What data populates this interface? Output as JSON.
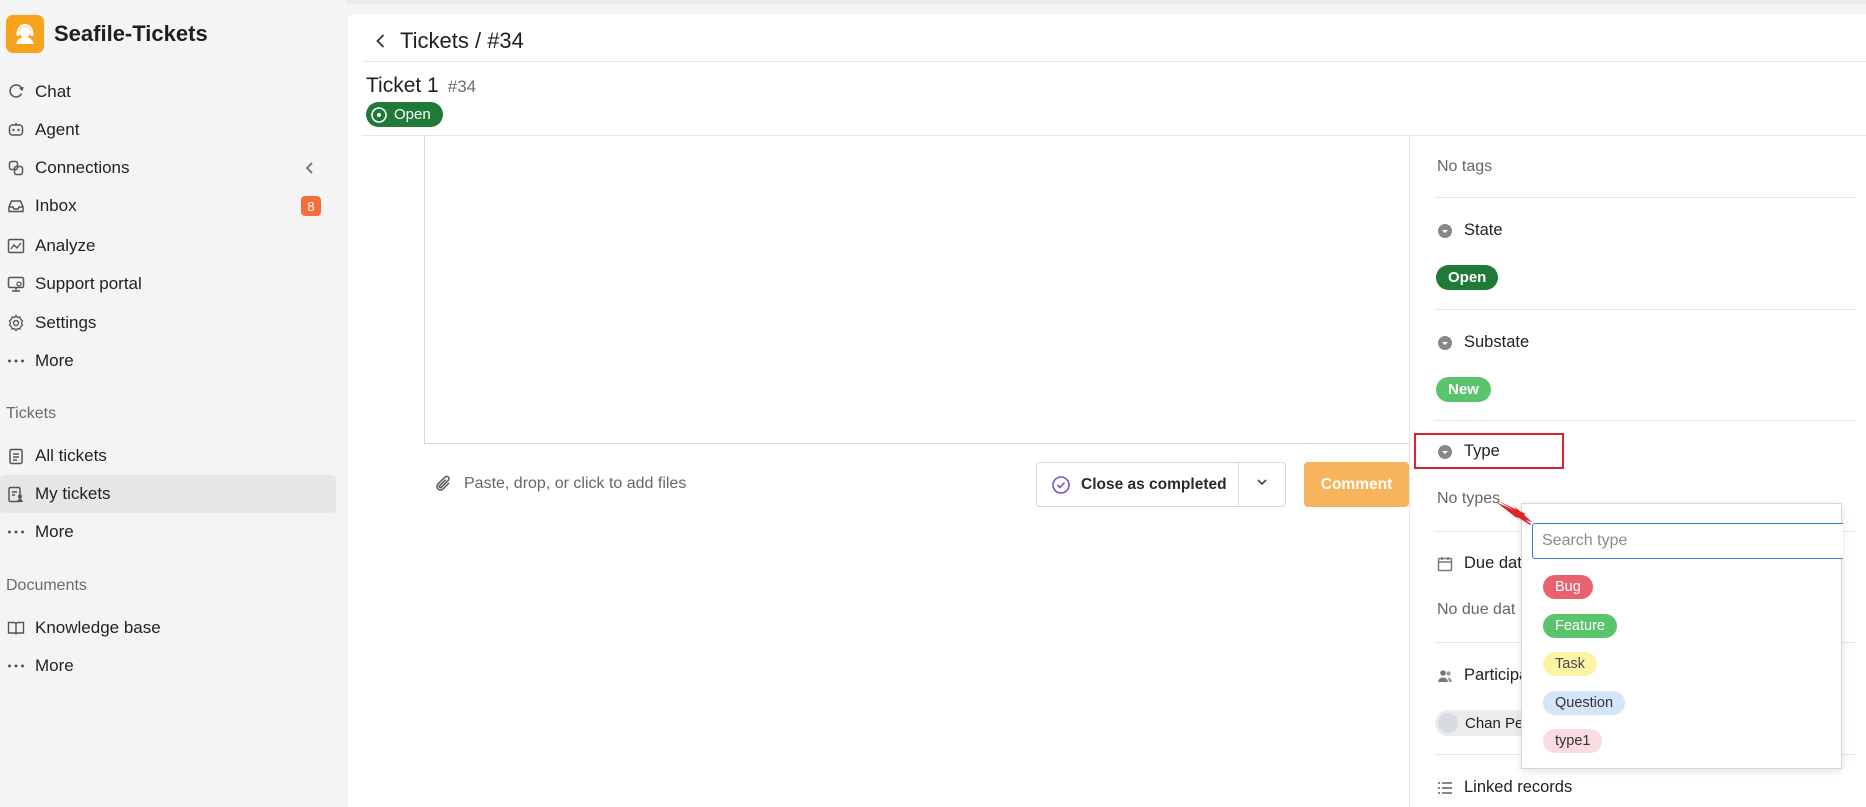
{
  "app": {
    "name": "Seafile-Tickets"
  },
  "sidebar": {
    "items": [
      {
        "label": "Chat",
        "icon": "chat-icon"
      },
      {
        "label": "Agent",
        "icon": "agent-icon"
      },
      {
        "label": "Connections",
        "icon": "connections-icon"
      },
      {
        "label": "Inbox",
        "icon": "inbox-icon",
        "badge": "8"
      },
      {
        "label": "Analyze",
        "icon": "analyze-icon"
      },
      {
        "label": "Support portal",
        "icon": "support-portal-icon"
      },
      {
        "label": "Settings",
        "icon": "gear-icon"
      },
      {
        "label": "More",
        "icon": "more-icon"
      }
    ],
    "tickets_section": {
      "title": "Tickets",
      "items": [
        {
          "label": "All tickets",
          "icon": "clipboard-icon"
        },
        {
          "label": "My tickets",
          "icon": "user-clipboard-icon",
          "active": true
        },
        {
          "label": "More",
          "icon": "more-icon"
        }
      ]
    },
    "documents_section": {
      "title": "Documents",
      "items": [
        {
          "label": "Knowledge base",
          "icon": "book-icon"
        },
        {
          "label": "More",
          "icon": "more-icon"
        }
      ]
    }
  },
  "header": {
    "breadcrumb": "Tickets / #34"
  },
  "ticket": {
    "title": "Ticket 1",
    "number": "#34",
    "status": "Open"
  },
  "composer": {
    "attach_text": "Paste, drop, or click to add files",
    "close_label": "Close as completed",
    "comment_label": "Comment"
  },
  "details": {
    "tags_empty": "No tags",
    "state": {
      "label": "State",
      "value": "Open"
    },
    "substate": {
      "label": "Substate",
      "value": "New"
    },
    "type": {
      "label": "Type",
      "empty": "No types"
    },
    "due_date": {
      "label": "Due dat",
      "empty": "No due dat"
    },
    "participants": {
      "label": "Participa",
      "person": "Chan Pe"
    },
    "linked_records": {
      "label": "Linked records"
    }
  },
  "type_dropdown": {
    "placeholder": "Search type",
    "options": [
      {
        "label": "Bug",
        "bg": "#e8616f",
        "fg": "#ffffff"
      },
      {
        "label": "Feature",
        "bg": "#59c46b",
        "fg": "#ffffff"
      },
      {
        "label": "Task",
        "bg": "#fbf3a6",
        "fg": "#4a4a4a"
      },
      {
        "label": "Question",
        "bg": "#d4e5fb",
        "fg": "#333333"
      },
      {
        "label": "type1",
        "bg": "#fadbe1",
        "fg": "#333333"
      }
    ]
  },
  "colors": {
    "brand": "#f7a21b",
    "open_green": "#1f7a38",
    "new_green": "#59c46b",
    "comment_orange": "#f8b45c",
    "badge_orange": "#f2703b",
    "highlight_red": "#e0232b"
  }
}
